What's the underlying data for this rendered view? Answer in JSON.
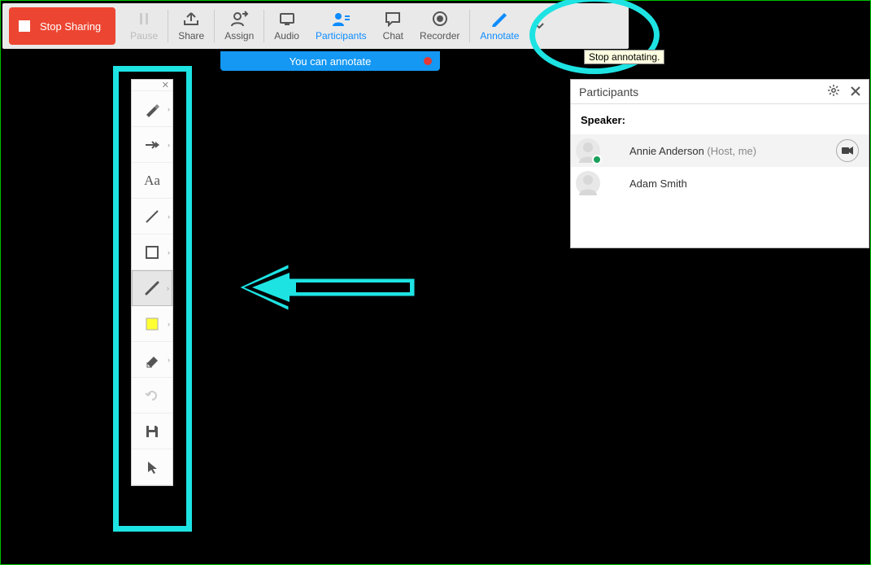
{
  "toolbar": {
    "stop_sharing": "Stop Sharing",
    "pause": "Pause",
    "share": "Share",
    "assign": "Assign",
    "audio": "Audio",
    "participants": "Participants",
    "chat": "Chat",
    "recorder": "Recorder",
    "annotate": "Annotate"
  },
  "tooltip": "Stop annotating.",
  "annotate_status": "You can annotate",
  "toolbox": {
    "items": [
      {
        "name": "highlighter",
        "caret": true
      },
      {
        "name": "arrow",
        "caret": true
      },
      {
        "name": "text",
        "label": "Aa",
        "caret": false
      },
      {
        "name": "line",
        "caret": true
      },
      {
        "name": "rectangle",
        "caret": true
      },
      {
        "name": "pencil",
        "caret": true,
        "selected": true
      },
      {
        "name": "fill-color",
        "color": "#ffff33",
        "caret": true
      },
      {
        "name": "eraser",
        "caret": true
      },
      {
        "name": "undo",
        "disabled": true,
        "caret": false
      },
      {
        "name": "save",
        "caret": false
      },
      {
        "name": "pointer",
        "caret": false
      }
    ]
  },
  "participants_panel": {
    "title": "Participants",
    "speaker_label": "Speaker:",
    "rows": [
      {
        "name": "Annie Anderson",
        "suffix": " (Host, me)",
        "presence": true,
        "camera": true,
        "striped": true
      },
      {
        "name": "Adam Smith",
        "suffix": "",
        "presence": false,
        "camera": false,
        "striped": false
      }
    ]
  }
}
